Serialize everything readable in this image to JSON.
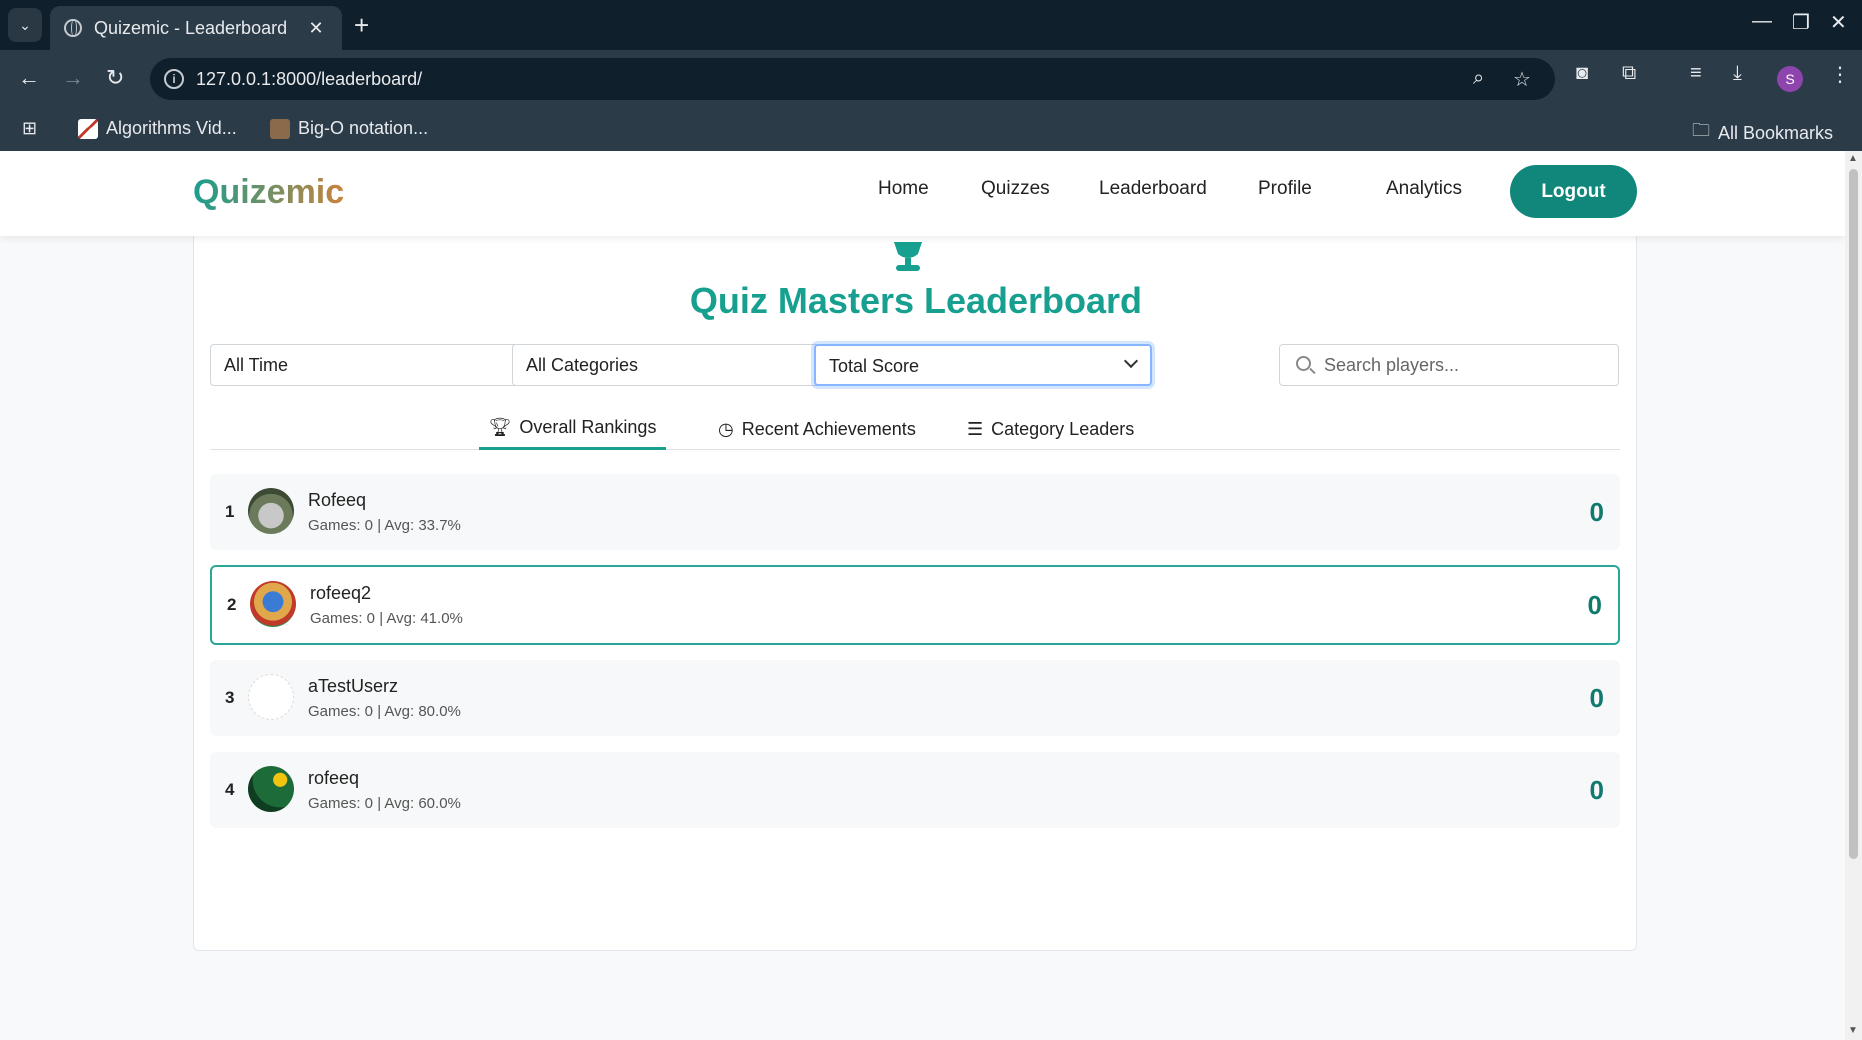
{
  "browser": {
    "tab_title": "Quizemic - Leaderboard",
    "url": "127.0.0.1:8000/leaderboard/",
    "bookmarks": [
      "Algorithms Vid...",
      "Big-O notation..."
    ],
    "all_bookmarks": "All Bookmarks",
    "profile_initial": "S"
  },
  "nav": {
    "brand": "Quizemic",
    "links": [
      "Home",
      "Quizzes",
      "Leaderboard",
      "Profile",
      "Analytics"
    ],
    "logout": "Logout"
  },
  "leaderboard": {
    "title": "Quiz Masters Leaderboard",
    "filters": {
      "period": "All Time",
      "category": "All Categories",
      "sort": "Total Score",
      "search_placeholder": "Search players..."
    },
    "tabs": [
      "Overall Rankings",
      "Recent Achievements",
      "Category Leaders"
    ],
    "active_tab": "Overall Rankings",
    "players": [
      {
        "rank": "1",
        "name": "Rofeeq",
        "meta": "Games: 0 | Avg: 33.7%",
        "score": "0"
      },
      {
        "rank": "2",
        "name": "rofeeq2",
        "meta": "Games: 0 | Avg: 41.0%",
        "score": "0",
        "current_user": true
      },
      {
        "rank": "3",
        "name": "aTestUserz",
        "meta": "Games: 0 | Avg: 80.0%",
        "score": "0"
      },
      {
        "rank": "4",
        "name": "rofeeq",
        "meta": "Games: 0 | Avg: 60.0%",
        "score": "0"
      }
    ]
  },
  "colors": {
    "accent": "#17a08f",
    "logout_bg": "#11867a",
    "score": "#117a6f",
    "highlight_border": "#2aa698"
  }
}
